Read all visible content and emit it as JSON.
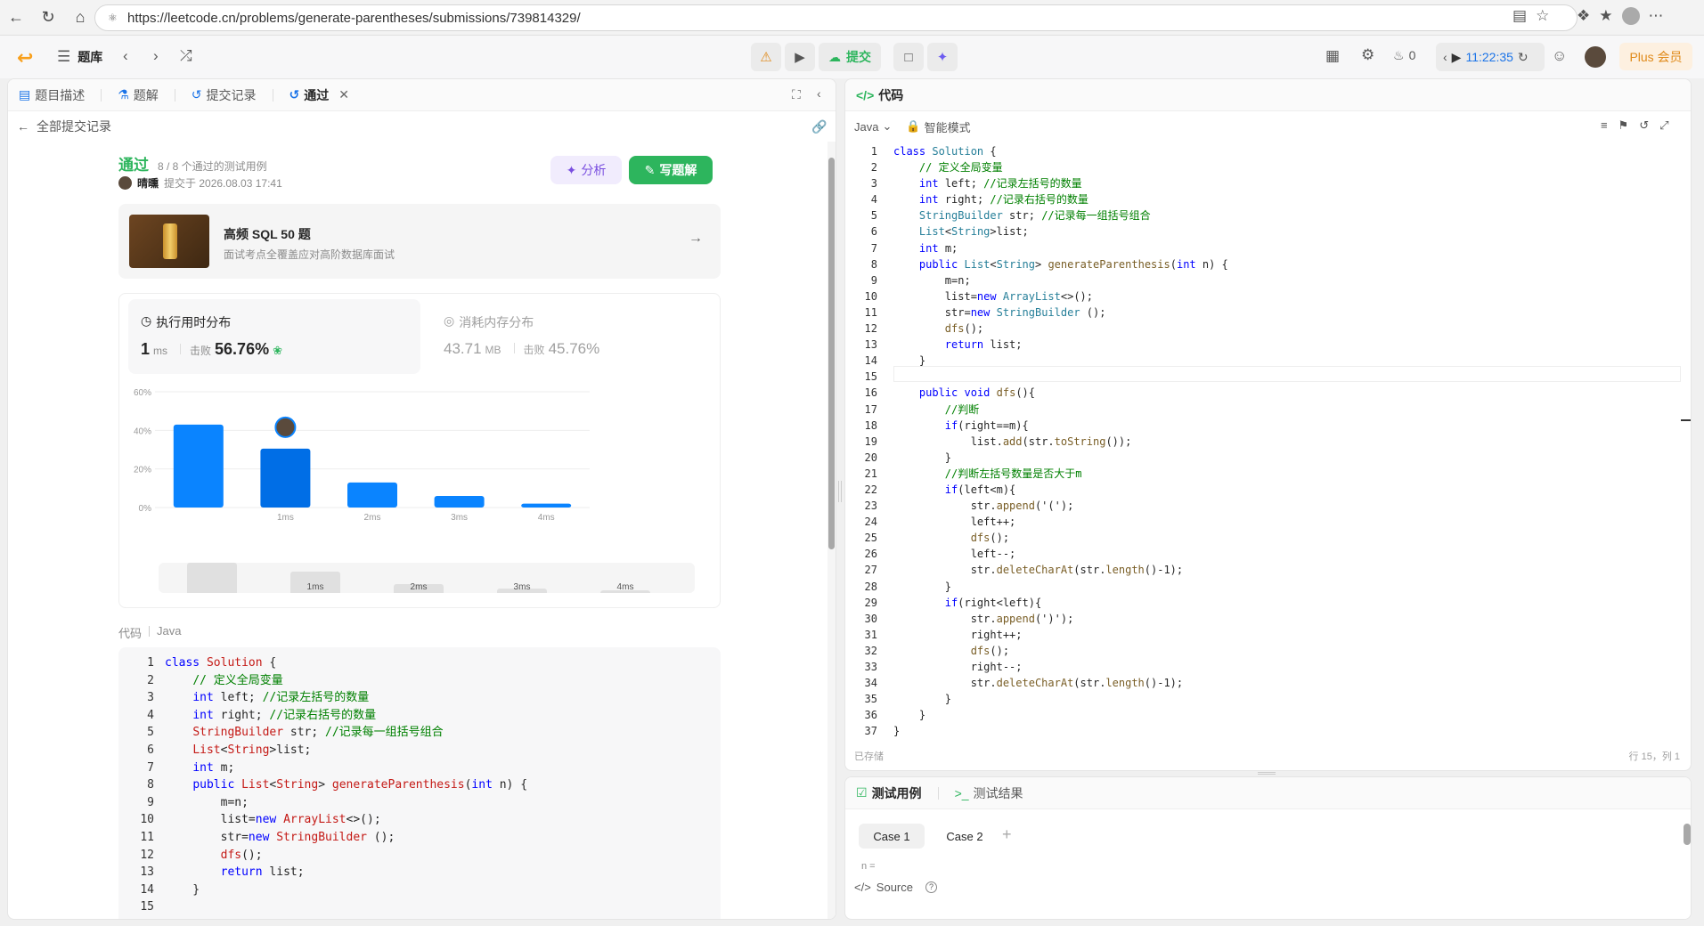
{
  "browser": {
    "url": "https://leetcode.cn/problems/generate-parentheses/submissions/739814329/"
  },
  "header": {
    "problem_bank": "题库",
    "submit_label": "提交",
    "fire_count": "0",
    "timer": "11:22:35",
    "plus_label": "Plus 会员"
  },
  "left_tabs": [
    {
      "label": "题目描述"
    },
    {
      "label": "题解"
    },
    {
      "label": "提交记录"
    },
    {
      "label": "通过"
    }
  ],
  "back_label": "全部提交记录",
  "result": {
    "status": "通过",
    "cases": "8 / 8 个通过的测试用例",
    "user": "晴曛",
    "submitted_at": "提交于 2026.08.03 17:41",
    "analysis_label": "分析",
    "write_solution_label": "写题解"
  },
  "promo": {
    "title": "高频 SQL 50 题",
    "subtitle": "面试考点全覆盖应对高阶数据库面试"
  },
  "runtime": {
    "title": "执行用时分布",
    "value": "1",
    "unit": "ms",
    "beats_label": "击败",
    "beats": "56.76%"
  },
  "memory": {
    "title": "消耗内存分布",
    "value": "43.71",
    "unit": "MB",
    "beats_label": "击败",
    "beats": "45.76%"
  },
  "chart_data": {
    "type": "bar",
    "categories": [
      "",
      "1ms",
      "2ms",
      "3ms",
      "4ms"
    ],
    "values": [
      43,
      30.5,
      13,
      6,
      2
    ],
    "yticks": [
      "60%",
      "40%",
      "20%",
      "0%"
    ],
    "ylim": [
      0,
      60
    ],
    "highlight_index": 1,
    "colors": {
      "bar": "#0a84ff",
      "highlight": "#006ee6"
    }
  },
  "mini_chart": {
    "labels": [
      "",
      "1ms",
      "2ms",
      "3ms",
      "4ms"
    ]
  },
  "code_section": {
    "label": "代码",
    "lang": "Java"
  },
  "submission_code": [
    "class Solution {",
    "    // 定义全局变量",
    "    int left; //记录左括号的数量",
    "    int right; //记录右括号的数量",
    "    StringBuilder str; //记录每一组括号组合",
    "    List<String>list;",
    "    int m;",
    "    public List<String> generateParenthesis(int n) {",
    "        m=n;",
    "        list=new ArrayList<>();",
    "        str=new StringBuilder ();",
    "        dfs();",
    "        return list;",
    "    }",
    ""
  ],
  "editor": {
    "title": "代码",
    "lang": "Java",
    "mode": "智能模式",
    "saved": "已存储",
    "cursor": "行 15，列 1",
    "lines": [
      "class Solution {",
      "    // 定义全局变量",
      "    int left; //记录左括号的数量",
      "    int right; //记录右括号的数量",
      "    StringBuilder str; //记录每一组括号组合",
      "    List<String>list;",
      "    int m;",
      "    public List<String> generateParenthesis(int n) {",
      "        m=n;",
      "        list=new ArrayList<>();",
      "        str=new StringBuilder ();",
      "        dfs();",
      "        return list;",
      "    }",
      "",
      "    public void dfs(){",
      "        //判断",
      "        if(right==m){",
      "            list.add(str.toString());",
      "        }",
      "        //判断左括号数量是否大于m",
      "        if(left<m){",
      "            str.append('(');",
      "            left++;",
      "            dfs();",
      "            left--;",
      "            str.deleteCharAt(str.length()-1);",
      "        }",
      "        if(right<left){",
      "            str.append(')');",
      "            right++;",
      "            dfs();",
      "            right--;",
      "            str.deleteCharAt(str.length()-1);",
      "        }",
      "    }",
      "}"
    ]
  },
  "test_panel": {
    "tab_cases": "测试用例",
    "tab_results": "测试结果",
    "case1": "Case 1",
    "case2": "Case 2",
    "add": "+",
    "param_label": "n =",
    "source_label": "Source"
  }
}
